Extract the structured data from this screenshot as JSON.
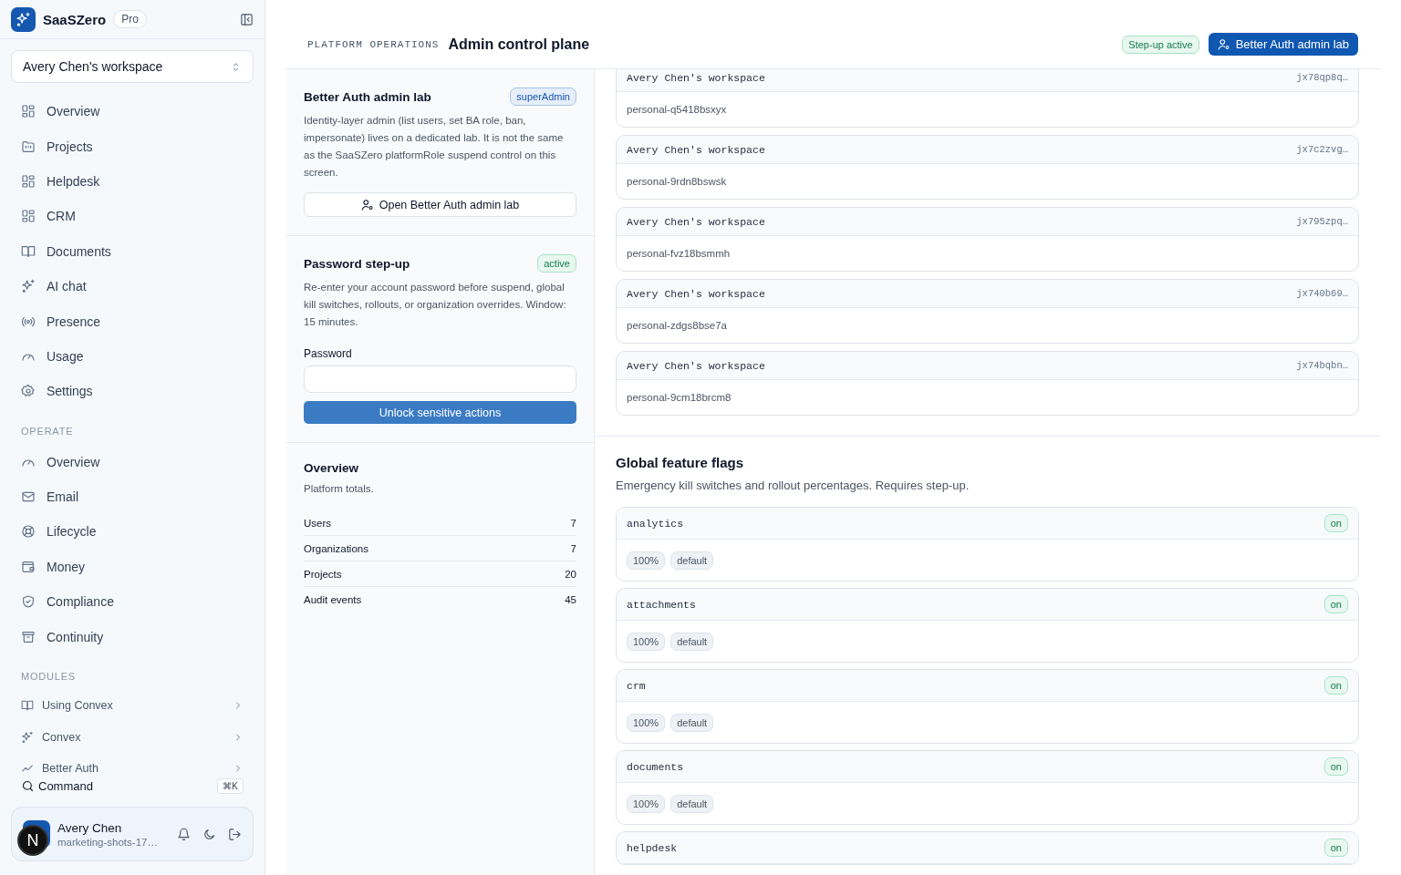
{
  "brand": {
    "name": "SaaSZero",
    "plan": "Pro"
  },
  "workspace_switcher": {
    "value": "Avery Chen's workspace"
  },
  "nav_sections": [
    {
      "items": [
        {
          "label": "Overview",
          "selected": false
        },
        {
          "label": "Projects",
          "selected": false
        },
        {
          "label": "Helpdesk",
          "selected": false
        },
        {
          "label": "CRM",
          "selected": false
        },
        {
          "label": "Documents",
          "selected": false
        },
        {
          "label": "AI chat",
          "selected": false
        },
        {
          "label": "Presence",
          "selected": false
        },
        {
          "label": "Usage",
          "selected": false
        },
        {
          "label": "Settings",
          "selected": false
        }
      ]
    },
    {
      "heading": "OPERATE",
      "items": [
        {
          "label": "Overview",
          "selected": false
        },
        {
          "label": "Email",
          "selected": false
        },
        {
          "label": "Lifecycle",
          "selected": false
        },
        {
          "label": "Money",
          "selected": false
        },
        {
          "label": "Compliance",
          "selected": false
        },
        {
          "label": "Continuity",
          "selected": false
        }
      ]
    },
    {
      "heading": "MODULES",
      "kind": "modules",
      "items": [
        {
          "label": "Using Convex",
          "selected": false
        },
        {
          "label": "Convex",
          "selected": false
        },
        {
          "label": "Better Auth",
          "selected": false
        }
      ]
    }
  ],
  "command": {
    "label": "Command",
    "shortcut": "⌘K"
  },
  "user": {
    "name": "Avery Chen",
    "subtitle": "marketing-shots-17…",
    "dev_badge": "N"
  },
  "header": {
    "eyebrow": "PLATFORM OPERATIONS",
    "title": "Admin control plane",
    "status_badge": "Step-up active",
    "action_button": "Better Auth admin lab"
  },
  "admin_lab": {
    "title": "Better Auth admin lab",
    "badge": "superAdmin",
    "description": "Identity-layer admin (list users, set BA role, ban, impersonate) lives on a dedicated lab. It is not the same as the SaaSZero platformRole suspend control on this screen.",
    "button": "Open Better Auth admin lab"
  },
  "step_up": {
    "title": "Password step-up",
    "badge": "active",
    "description": "Re-enter your account password before suspend, global kill switches, rollouts, or organization overrides. Window: 15 minutes.",
    "field_label": "Password",
    "button": "Unlock sensitive actions"
  },
  "overview": {
    "title": "Overview",
    "subtitle": "Platform totals.",
    "rows": [
      {
        "label": "Users",
        "value": "7"
      },
      {
        "label": "Organizations",
        "value": "7"
      },
      {
        "label": "Projects",
        "value": "20"
      },
      {
        "label": "Audit events",
        "value": "45"
      }
    ]
  },
  "workspaces": [
    {
      "name": "Avery Chen's workspace",
      "id": "jx78qp8q…",
      "slug": "personal-q5418bsxyx"
    },
    {
      "name": "Avery Chen's workspace",
      "id": "jx7c2zvg…",
      "slug": "personal-9rdn8bswsk"
    },
    {
      "name": "Avery Chen's workspace",
      "id": "jx795zpq…",
      "slug": "personal-fvz18bsmmh"
    },
    {
      "name": "Avery Chen's workspace",
      "id": "jx740b69…",
      "slug": "personal-zdgs8bse7a"
    },
    {
      "name": "Avery Chen's workspace",
      "id": "jx74bqbn…",
      "slug": "personal-9cm18brcm8"
    }
  ],
  "feature_flags": {
    "title": "Global feature flags",
    "description": "Emergency kill switches and rollout percentages. Requires step-up.",
    "items": [
      {
        "key": "analytics",
        "status": "on",
        "rollout": "100%",
        "tag": "default"
      },
      {
        "key": "attachments",
        "status": "on",
        "rollout": "100%",
        "tag": "default"
      },
      {
        "key": "crm",
        "status": "on",
        "rollout": "100%",
        "tag": "default"
      },
      {
        "key": "documents",
        "status": "on",
        "rollout": "100%",
        "tag": "default"
      },
      {
        "key": "helpdesk",
        "status": "on"
      }
    ]
  }
}
